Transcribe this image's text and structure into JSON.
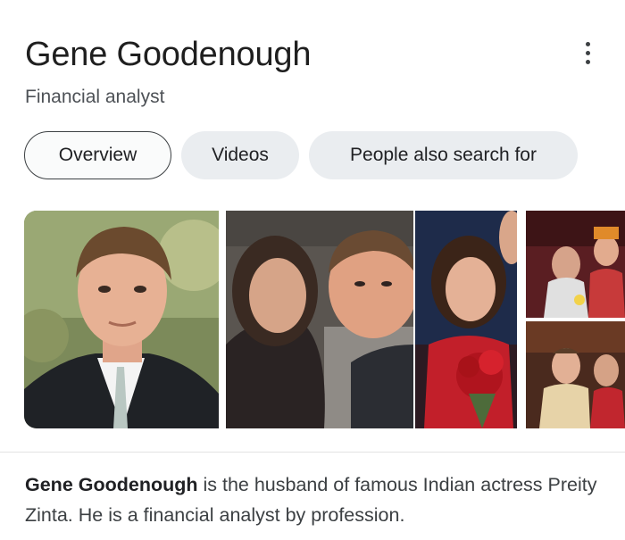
{
  "header": {
    "title": "Gene Goodenough",
    "subtitle": "Financial analyst",
    "more_icon": "more-vert-icon"
  },
  "tabs": [
    {
      "label": "Overview",
      "selected": true
    },
    {
      "label": "Videos",
      "selected": false
    },
    {
      "label": "People also search for",
      "selected": false
    }
  ],
  "images": [
    {
      "name": "portrait-photo"
    },
    {
      "name": "couple-selfie-photo"
    },
    {
      "name": "red-dress-bouquet-photo"
    },
    {
      "name": "wedding-ceremony-photo"
    },
    {
      "name": "wedding-couple-photo"
    }
  ],
  "description": {
    "bold": "Gene Goodenough",
    "text": " is the husband of famous Indian actress Preity Zinta. He is a financial analyst by profession."
  },
  "colors": {
    "selected_chip_border": "#3c4043",
    "chip_background": "#eaedf0",
    "text_primary": "#202124",
    "text_secondary": "#4d5156"
  }
}
